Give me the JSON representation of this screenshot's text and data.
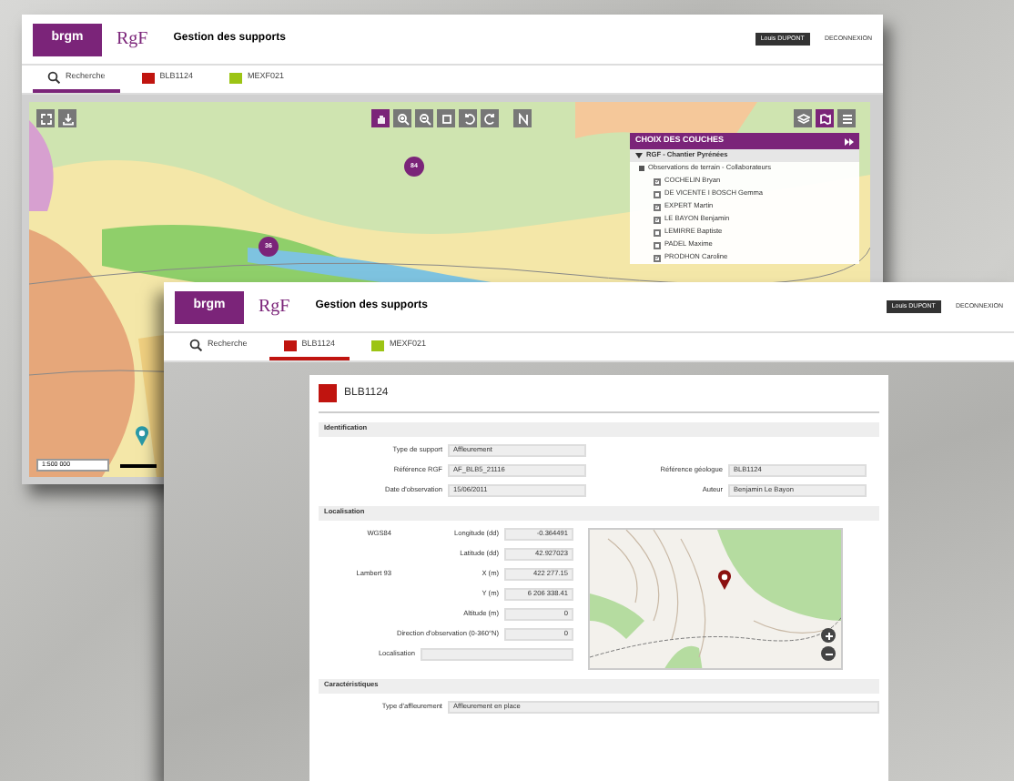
{
  "back_window": {
    "header": {
      "logo": "brgm",
      "brand": "RgF",
      "title": "Gestion des supports",
      "user": "Louis DUPONT",
      "logout": "DECONNEXION"
    },
    "tabs": [
      {
        "label": "Recherche",
        "kind": "search",
        "selected": true
      },
      {
        "label": "BLB1124",
        "kind": "record",
        "color": "#c0140f",
        "selected": false
      },
      {
        "label": "MEXF021",
        "kind": "record",
        "color": "#9cc414",
        "selected": false
      }
    ],
    "map": {
      "markers": [
        {
          "label": "84"
        },
        {
          "label": "36"
        }
      ],
      "scale": "1:500 000",
      "layers": {
        "title": "CHOIX DES COUCHES",
        "group": "RGF - Chantier Pyrénées",
        "subgroup": "Observations de terrain - Collaborateurs",
        "items": [
          {
            "label": "COCHELIN Bryan",
            "checked": true
          },
          {
            "label": "DE VICENTE I BOSCH Gemma",
            "checked": false
          },
          {
            "label": "EXPERT Martin",
            "checked": true
          },
          {
            "label": "LE BAYON Benjamin",
            "checked": true
          },
          {
            "label": "LEMIRRE Baptiste",
            "checked": false
          },
          {
            "label": "PADEL Maxime",
            "checked": false
          },
          {
            "label": "PRODHON Caroline",
            "checked": true
          }
        ]
      }
    }
  },
  "front_window": {
    "header": {
      "logo": "brgm",
      "brand": "RgF",
      "title": "Gestion des supports",
      "user": "Louis DUPONT",
      "logout": "DECONNEXION"
    },
    "tabs": [
      {
        "label": "Recherche",
        "kind": "search",
        "selected": false
      },
      {
        "label": "BLB1124",
        "kind": "record",
        "color": "#c0140f",
        "selected": true
      },
      {
        "label": "MEXF021",
        "kind": "record",
        "color": "#9cc414",
        "selected": false
      }
    ],
    "record": {
      "title": "BLB1124",
      "color": "#c0140f",
      "sections": [
        {
          "title": "Identification",
          "kind": "form",
          "rows": [
            [
              {
                "label": "Type de support",
                "value": "Affleurement"
              }
            ],
            [
              {
                "label": "Référence RGF",
                "value": "AF_BLB5_21116"
              },
              {
                "label": "Référence géologue",
                "value": "BLB1124"
              }
            ],
            [
              {
                "label": "Date d'observation",
                "value": "15/06/2011"
              },
              {
                "label": "Auteur",
                "value": "Benjamin Le Bayon"
              }
            ]
          ]
        },
        {
          "title": "Localisation",
          "kind": "location",
          "fields": [
            {
              "group": "WGS84",
              "label": "Longitude (dd)",
              "value": "-0.364491"
            },
            {
              "label": "Latitude (dd)",
              "value": "42.927023"
            },
            {
              "group": "Lambert 93",
              "label": "X (m)",
              "value": "422 277.15"
            },
            {
              "label": "Y (m)",
              "value": "6 206 338.41"
            },
            {
              "label": "Altitude (m)",
              "value": "0"
            },
            {
              "label": "Direction d'observation (0-360°N)",
              "value": "0"
            },
            {
              "label": "Localisation"
            }
          ]
        },
        {
          "title": "Caractéristiques",
          "kind": "full-width",
          "rows": [
            [
              {
                "label": "Type d'affleurement",
                "value": "Affleurement en place"
              }
            ]
          ]
        }
      ]
    }
  }
}
